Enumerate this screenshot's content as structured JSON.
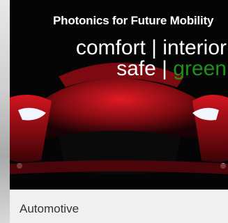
{
  "card": {
    "tagline": "Photonics for Future Mobility",
    "headline_1": "comfort | interior",
    "headline_2_prefix": "safe | ",
    "headline_2_green": "green",
    "category": "Automotive"
  },
  "colors": {
    "accent_green": "#1f8f1f",
    "car_red": "#c0111b",
    "image_background": "#050505"
  },
  "icons": [
    "car-image"
  ]
}
